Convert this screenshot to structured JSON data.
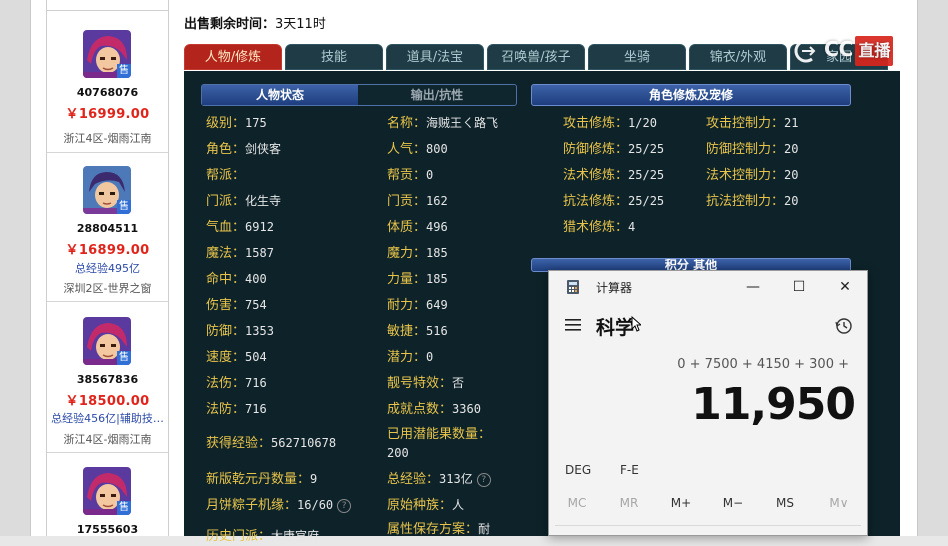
{
  "header": {
    "top_cut_text": "",
    "sale_time_label": "出售剩余时间：",
    "sale_time_value": "3天11时"
  },
  "tabs": [
    {
      "label": "人物/修炼",
      "active": true
    },
    {
      "label": "技能",
      "active": false
    },
    {
      "label": "道具/法宝",
      "active": false
    },
    {
      "label": "召唤兽/孩子",
      "active": false
    },
    {
      "label": "坐骑",
      "active": false
    },
    {
      "label": "锦衣/外观",
      "active": false
    },
    {
      "label": "家园",
      "active": false
    }
  ],
  "listings": [
    {
      "id": "40768076",
      "price": "￥16999.00",
      "note": "",
      "server": "浙江4区-烟雨江南",
      "sale_tag": "售"
    },
    {
      "id": "28804511",
      "price": "￥16899.00",
      "note": "总经验495亿",
      "server": "深圳2区-世界之窗",
      "sale_tag": "售"
    },
    {
      "id": "38567836",
      "price": "￥18500.00",
      "note": "总经验456亿|辅助技…",
      "server": "浙江4区-烟雨江南",
      "sale_tag": "售"
    },
    {
      "id": "17555603",
      "price": "",
      "note": "",
      "server": "",
      "sale_tag": "售"
    }
  ],
  "panel": {
    "section_status": "人物状态",
    "section_output": "输出/抗性",
    "section_cultivation": "角色修炼及宠修",
    "section_other": "积分 其他",
    "stats_left": [
      {
        "k": "级别：",
        "v": "175"
      },
      {
        "k": "角色：",
        "v": "剑侠客"
      },
      {
        "k": "帮派：",
        "v": ""
      },
      {
        "k": "门派：",
        "v": "化生寺"
      },
      {
        "k": "气血：",
        "v": "6912"
      },
      {
        "k": "魔法：",
        "v": "1587"
      },
      {
        "k": "命中：",
        "v": "400"
      },
      {
        "k": "伤害：",
        "v": "754"
      },
      {
        "k": "防御：",
        "v": "1353"
      },
      {
        "k": "速度：",
        "v": "504"
      },
      {
        "k": "法伤：",
        "v": "716"
      },
      {
        "k": "法防：",
        "v": "716"
      }
    ],
    "stats_mid": [
      {
        "k": "名称：",
        "v": "海贼王ㄑ路飞"
      },
      {
        "k": "人气：",
        "v": "800"
      },
      {
        "k": "帮贡：",
        "v": "0"
      },
      {
        "k": "门贡：",
        "v": "162"
      },
      {
        "k": "体质：",
        "v": "496"
      },
      {
        "k": "魔力：",
        "v": "185"
      },
      {
        "k": "力量：",
        "v": "185"
      },
      {
        "k": "耐力：",
        "v": "649"
      },
      {
        "k": "敏捷：",
        "v": "516"
      },
      {
        "k": "潜力：",
        "v": "0"
      },
      {
        "k": "靓号特效：",
        "v": "否"
      },
      {
        "k": "成就点数：",
        "v": "3360"
      }
    ],
    "extra_left": [
      {
        "k": "获得经验：",
        "v": "562710678"
      },
      {
        "k": "新版乾元丹数量：",
        "v": "9"
      },
      {
        "k": "月饼粽子机缘：",
        "v": "16/60"
      },
      {
        "k": "历史门派：",
        "v": "大唐官府"
      }
    ],
    "extra_mid": [
      {
        "k": "已用潜能果数量：",
        "v": "200"
      },
      {
        "k": "总经验：",
        "v": "313亿"
      },
      {
        "k": "原始种族：",
        "v": "人"
      },
      {
        "k": "属性保存方案：",
        "v": "耐"
      }
    ],
    "cultivation": [
      {
        "k": "攻击修炼：",
        "v": "1/20",
        "k2": "攻击控制力：",
        "v2": "21"
      },
      {
        "k": "防御修炼：",
        "v": "25/25",
        "k2": "防御控制力：",
        "v2": "20"
      },
      {
        "k": "法术修炼：",
        "v": "25/25",
        "k2": "法术控制力：",
        "v2": "20"
      },
      {
        "k": "抗法修炼：",
        "v": "25/25",
        "k2": "抗法控制力：",
        "v2": "20"
      },
      {
        "k": "猎术修炼：",
        "v": "4",
        "k2": "",
        "v2": ""
      }
    ]
  },
  "watermark": {
    "text": "CC",
    "tail": "直播"
  },
  "calculator": {
    "title": "计算器",
    "mode": "科学",
    "expression": "0 + 7500 + 4150 + 300 +",
    "result": "11,950",
    "toggles": [
      "DEG",
      "F-E"
    ],
    "memory": [
      {
        "label": "MC",
        "enabled": false
      },
      {
        "label": "MR",
        "enabled": false
      },
      {
        "label": "M+",
        "enabled": true
      },
      {
        "label": "M−",
        "enabled": true
      },
      {
        "label": "MS",
        "enabled": true
      },
      {
        "label": "M∨",
        "enabled": false
      }
    ],
    "min_glyph": "—",
    "max_glyph": "☐",
    "close_glyph": "✕"
  }
}
